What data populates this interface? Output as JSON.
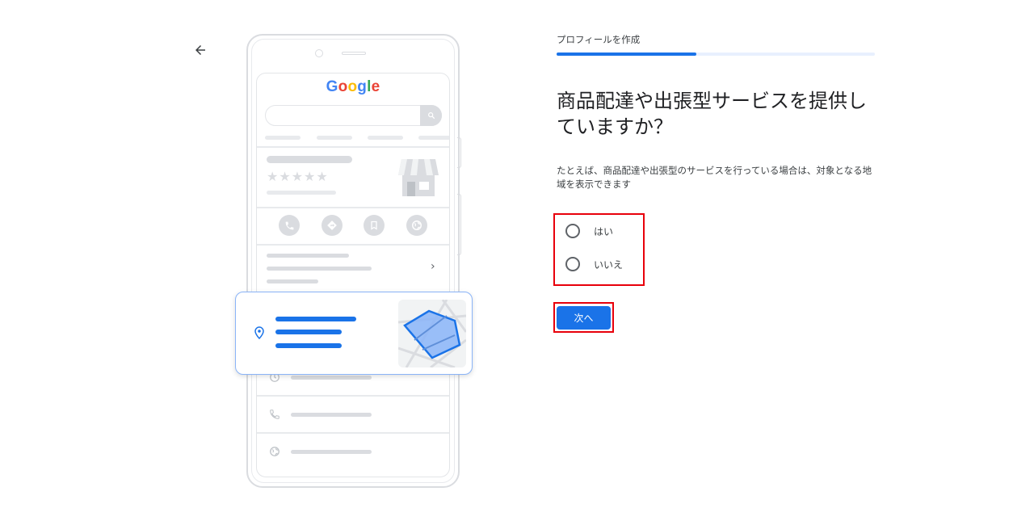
{
  "header": {
    "back_icon": "arrow-back-icon",
    "step_label": "プロフィールを作成",
    "progress": 0.44
  },
  "question": {
    "title": "商品配達や出張型サービスを提供していますか？",
    "help_text": "たとえば、商品配達や出張型のサービスを行っている場合は、対象となる地域を表示できます"
  },
  "options": [
    {
      "label": "はい",
      "selected": false
    },
    {
      "label": "いいえ",
      "selected": false
    }
  ],
  "next_button": {
    "label": "次へ"
  },
  "illustration": {
    "logo": "Google",
    "rating_stars": "★★★★★",
    "colors": {
      "accent": "#1a73e8",
      "highlight": "#e8000b"
    }
  }
}
